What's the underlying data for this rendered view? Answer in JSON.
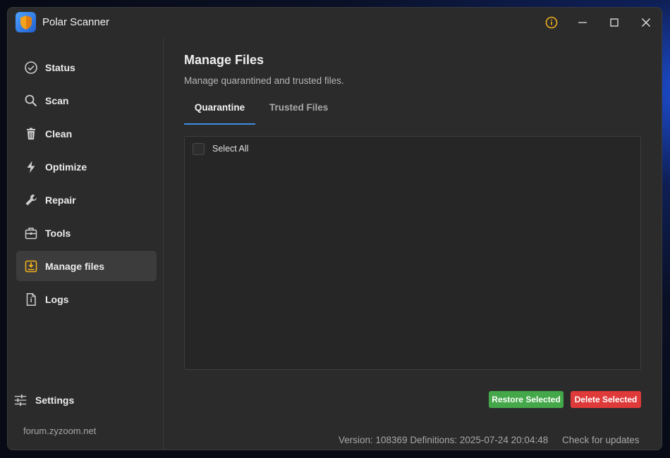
{
  "window": {
    "title": "Polar Scanner"
  },
  "sidebar": {
    "items": [
      {
        "label": "Status",
        "icon": "check-circle-icon"
      },
      {
        "label": "Scan",
        "icon": "search-icon"
      },
      {
        "label": "Clean",
        "icon": "trash-icon"
      },
      {
        "label": "Optimize",
        "icon": "lightning-icon"
      },
      {
        "label": "Repair",
        "icon": "wrench-icon"
      },
      {
        "label": "Tools",
        "icon": "toolbox-icon"
      },
      {
        "label": "Manage files",
        "icon": "download-box-icon",
        "active": true
      },
      {
        "label": "Logs",
        "icon": "file-info-icon"
      }
    ],
    "settings_label": "Settings",
    "forum_link": "forum.zyzoom.net"
  },
  "main": {
    "title": "Manage Files",
    "subtitle": "Manage quarantined and trusted files.",
    "tabs": [
      {
        "label": "Quarantine",
        "active": true
      },
      {
        "label": "Trusted Files",
        "active": false
      }
    ],
    "select_all_label": "Select All",
    "restore_label": "Restore Selected",
    "delete_label": "Delete Selected"
  },
  "footer": {
    "version": "Version: 108369 Definitions: 2025-07-24 20:04:48",
    "check_updates": "Check for updates"
  },
  "colors": {
    "accent": "#3d8ee0",
    "active_icon": "#f2b01e",
    "restore": "#44a84a",
    "delete": "#df3a3a",
    "info": "#f2b01e"
  }
}
